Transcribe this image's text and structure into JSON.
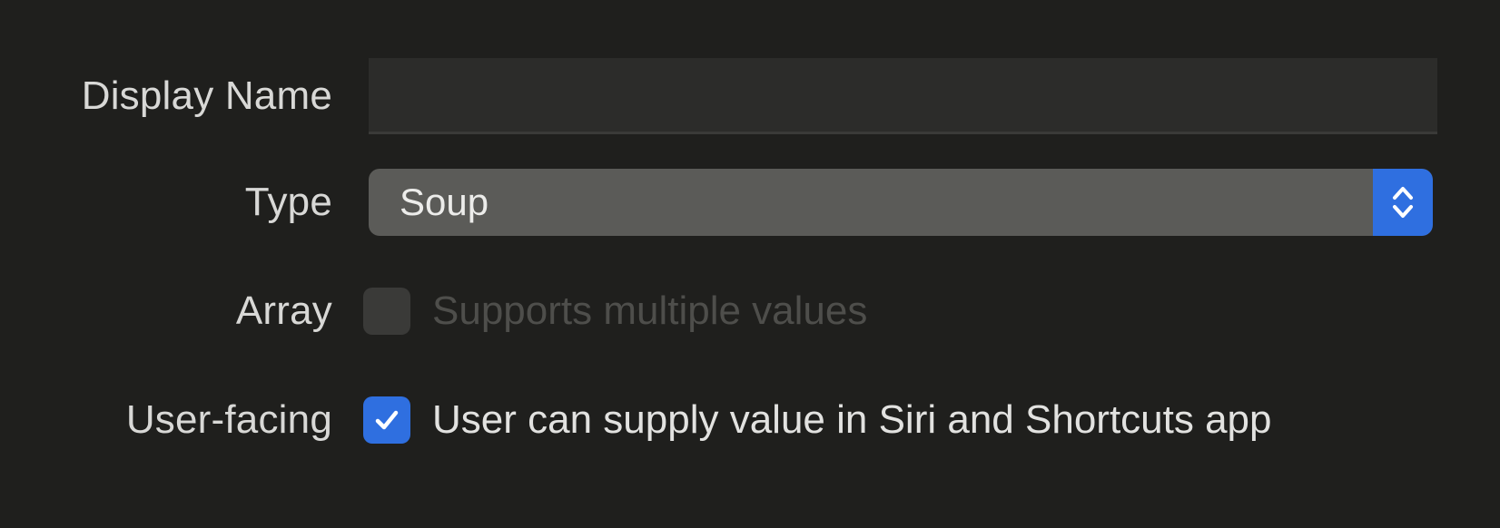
{
  "form": {
    "display_name": {
      "label": "Display Name",
      "value": "",
      "placeholder": ""
    },
    "type": {
      "label": "Type",
      "selected": "Soup",
      "icon": "chevron-up-down-icon"
    },
    "array": {
      "label": "Array",
      "checkbox_label": "Supports multiple values",
      "checked": false,
      "enabled": false
    },
    "user_facing": {
      "label": "User-facing",
      "checkbox_label": "User can supply value in Siri and Shortcuts app",
      "checked": true,
      "enabled": true,
      "icon": "checkmark-icon"
    }
  },
  "colors": {
    "background": "#1f1f1d",
    "accent": "#2f6fe0",
    "popup": "#5b5b58",
    "field": "#2c2c2a"
  }
}
